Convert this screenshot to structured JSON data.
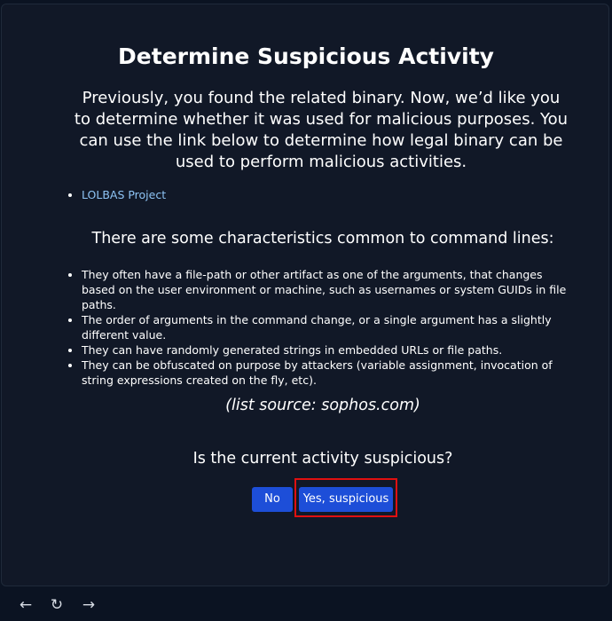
{
  "header": {
    "title": "Determine Suspicious Activity"
  },
  "intro": {
    "text": "Previously, you found the related binary. Now, we’d like you to determine whether it was used for malicious purposes. You can use the link below to determine how legal binary can be used to perform malicious activities."
  },
  "links": {
    "items": [
      "LOLBAS Project"
    ]
  },
  "characteristics": {
    "heading": "There are some characteristics common to command lines:",
    "items": [
      "They often have a file-path or other artifact as one of the arguments, that changes based on the user environment or machine, such as usernames or system GUIDs in file paths.",
      "The order of arguments in the command change, or a single argument has a slightly different value.",
      "They can have randomly generated strings in embedded URLs or file paths.",
      "They can be obfuscated on purpose by attackers (variable assignment, invocation of string expressions created on the fly, etc)."
    ],
    "source": "(list source: sophos.com)"
  },
  "question": {
    "text": "Is the current activity suspicious?",
    "no_label": "No",
    "yes_label": "Yes, suspicious"
  },
  "nav": {
    "back_icon": "←",
    "reload_icon": "↻",
    "forward_icon": "→"
  },
  "colors": {
    "background": "#111827",
    "button": "#1d4ed8",
    "link": "#8ec4f5",
    "highlight": "#e01010"
  }
}
